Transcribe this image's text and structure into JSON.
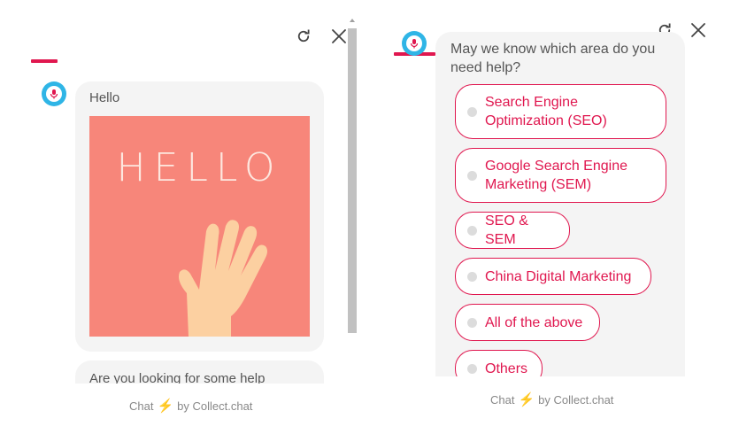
{
  "left_panel": {
    "messages": [
      {
        "text": "Hello"
      },
      {
        "text": "Are you looking for some help"
      }
    ],
    "hello_image": {
      "text": "HELLO",
      "bg_color": "#f7867a",
      "hand_color": "#fcd0a1"
    },
    "footer": {
      "prefix": "Chat",
      "suffix": "by Collect.chat"
    }
  },
  "right_panel": {
    "question": "May we know which area do you need help?",
    "options": [
      {
        "label": "Search Engine Optimization (SEO)"
      },
      {
        "label": "Google Search Engine Marketing (SEM)"
      },
      {
        "label": "SEO & SEM"
      },
      {
        "label": "China Digital Marketing"
      },
      {
        "label": "All of the above"
      },
      {
        "label": "Others"
      }
    ],
    "footer": {
      "prefix": "Chat",
      "suffix": "by Collect.chat"
    }
  },
  "icons": {
    "refresh": "refresh-icon",
    "close": "close-icon",
    "bolt": "lightning-bolt-icon",
    "avatar": "bot-avatar-icon"
  },
  "colors": {
    "accent": "#e0174f",
    "avatar_bg": "#2fb5e6",
    "bubble_bg": "#f4f4f4",
    "bolt": "#f5a623"
  }
}
